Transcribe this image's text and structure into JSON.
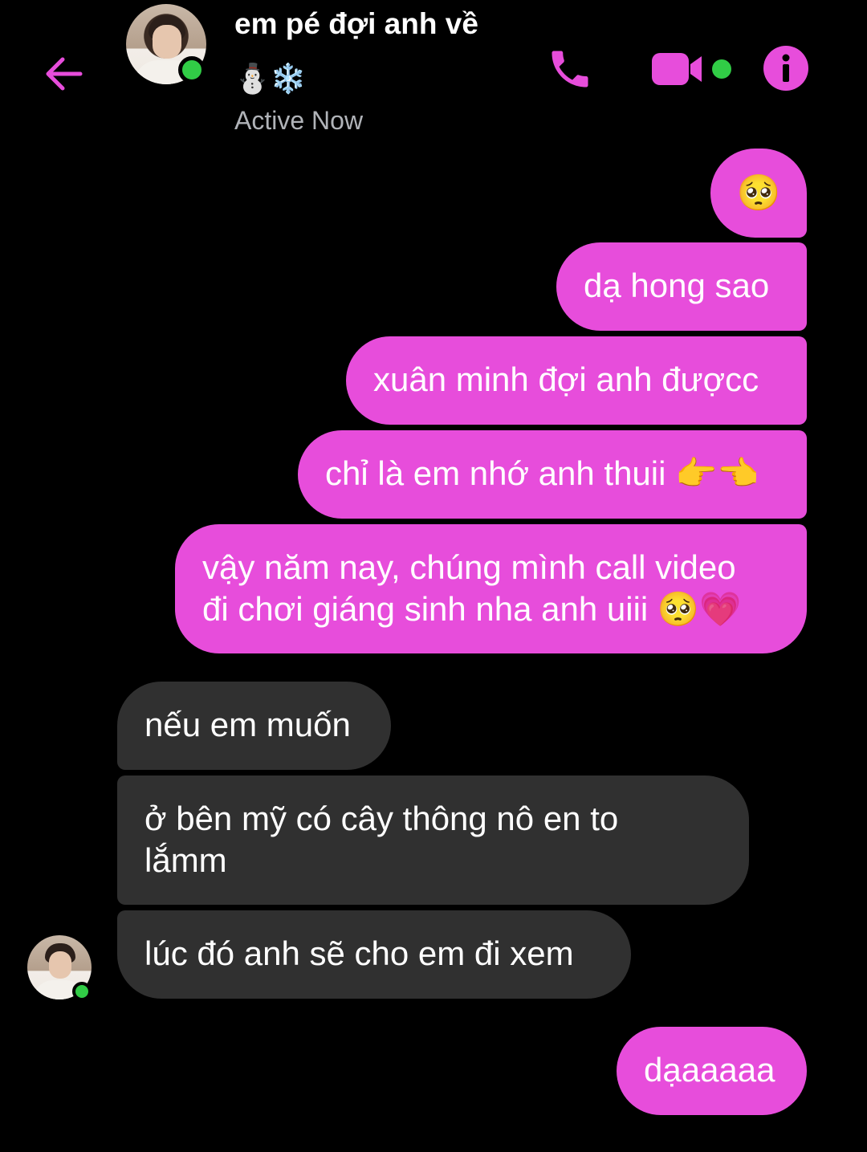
{
  "header": {
    "contact_name": "em pé đợi anh về",
    "name_emojis": "⛄❄️",
    "status": "Active Now",
    "accent_color": "#e74ddb",
    "icons": [
      "back-arrow-icon",
      "phone-icon",
      "video-camera-icon",
      "info-icon"
    ]
  },
  "messages": [
    {
      "sender": "me",
      "text": "🥺"
    },
    {
      "sender": "me",
      "text": "dạ hong sao"
    },
    {
      "sender": "me",
      "text": "xuân minh đợi anh đượcc"
    },
    {
      "sender": "me",
      "text": "chỉ là em nhớ anh thuii 👉👈"
    },
    {
      "sender": "me",
      "text": "vậy năm nay, chúng mình call video\nđi chơi giáng sinh nha anh uiii 🥺💗"
    },
    {
      "sender": "them",
      "text": "nếu em muốn"
    },
    {
      "sender": "them",
      "text": "ở bên mỹ có cây thông nô en to\nlắmm"
    },
    {
      "sender": "them",
      "text": "lúc đó anh sẽ cho em đi xem"
    },
    {
      "sender": "me",
      "text": "dạaaaaa"
    }
  ]
}
